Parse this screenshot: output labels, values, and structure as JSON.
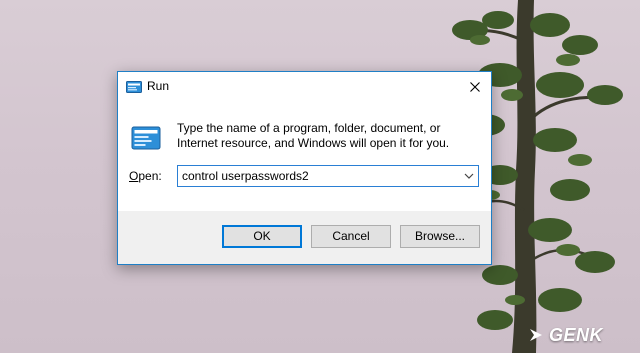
{
  "window": {
    "title": "Run",
    "icon": "run-icon",
    "close_icon": "close-icon"
  },
  "dialog": {
    "description": "Type the name of a program, folder, document, or Internet resource, and Windows will open it for you.",
    "open_label_accel": "O",
    "open_label_rest": "pen:",
    "open_value": "control userpasswords2",
    "dropdown_icon": "chevron-down-icon"
  },
  "buttons": {
    "ok": "OK",
    "cancel": "Cancel",
    "browse": "Browse..."
  },
  "watermark": {
    "text": "GENK"
  },
  "colors": {
    "accent": "#0078d7",
    "dialog_border": "#1f7fc6",
    "footer_bg": "#f0f0f0"
  }
}
